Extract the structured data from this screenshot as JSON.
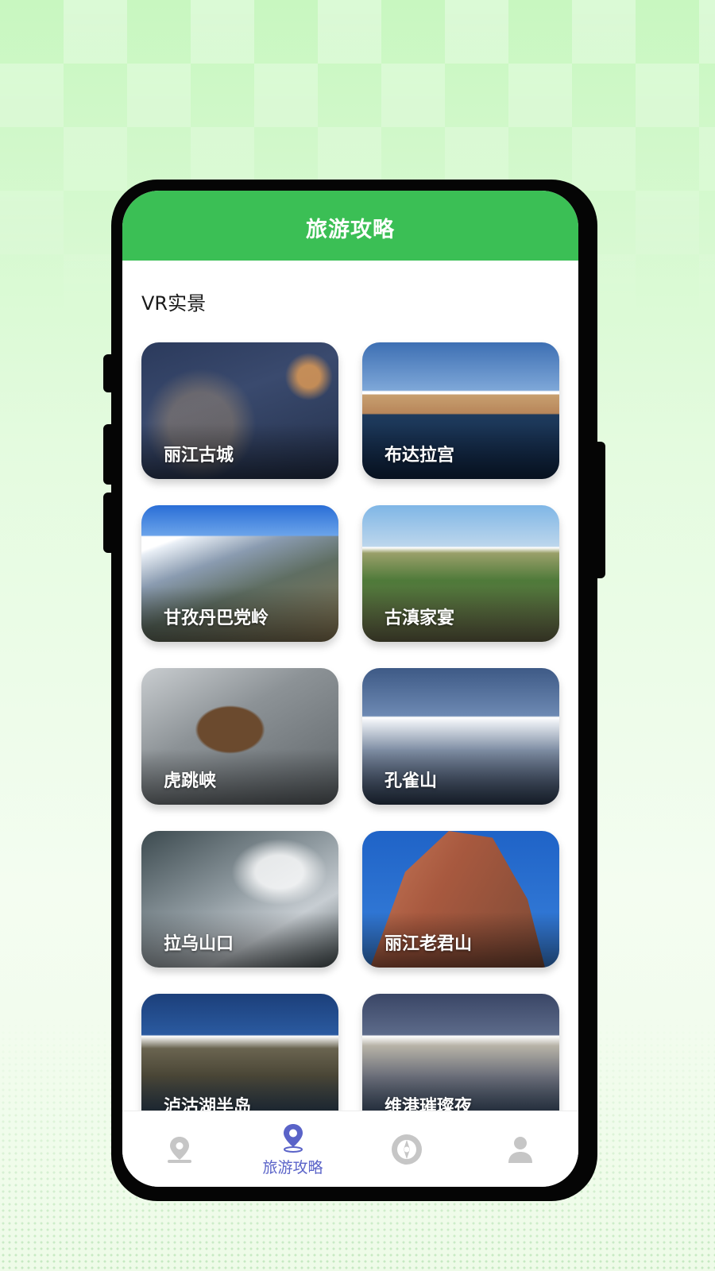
{
  "header": {
    "title": "旅游攻略"
  },
  "section": {
    "title": "VR实景"
  },
  "cards": [
    {
      "label": "丽江古城"
    },
    {
      "label": "布达拉宫"
    },
    {
      "label": "甘孜丹巴党岭"
    },
    {
      "label": "古滇家宴"
    },
    {
      "label": "虎跳峡"
    },
    {
      "label": "孔雀山"
    },
    {
      "label": "拉乌山口"
    },
    {
      "label": "丽江老君山"
    },
    {
      "label": "泸沽湖半岛"
    },
    {
      "label": "维港璀璨夜"
    }
  ],
  "tabbar": {
    "active_index": 1,
    "tabs": [
      {
        "icon": "location-pin-icon",
        "label": ""
      },
      {
        "icon": "map-pin-icon",
        "label": "旅游攻略"
      },
      {
        "icon": "compass-icon",
        "label": ""
      },
      {
        "icon": "user-icon",
        "label": ""
      }
    ]
  },
  "colors": {
    "accent_green": "#3bbf55",
    "active_tab": "#5a63c8",
    "inactive_tab": "#c4c4c4"
  }
}
